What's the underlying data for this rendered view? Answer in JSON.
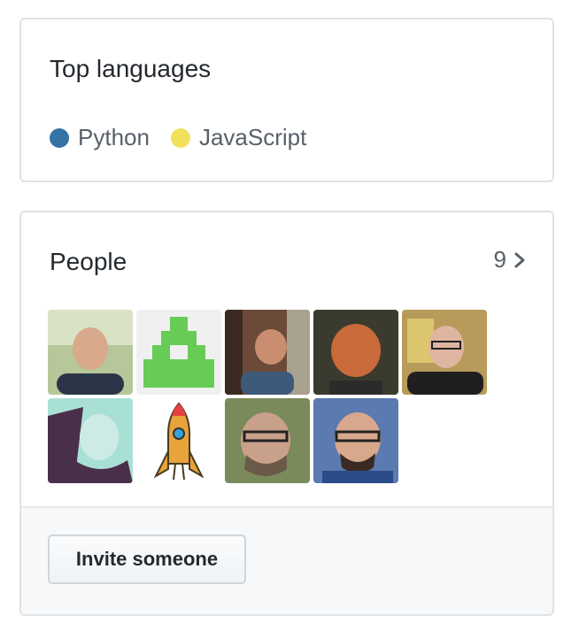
{
  "top_languages": {
    "title": "Top languages",
    "languages": [
      {
        "name": "Python",
        "color": "#3572A5"
      },
      {
        "name": "JavaScript",
        "color": "#f1e05a"
      }
    ]
  },
  "people": {
    "title": "People",
    "count": "9",
    "invite_label": "Invite someone"
  },
  "colors": {
    "border": "#dfe2e5",
    "footer_bg": "#f6f8fa",
    "muted_text": "#586069"
  }
}
